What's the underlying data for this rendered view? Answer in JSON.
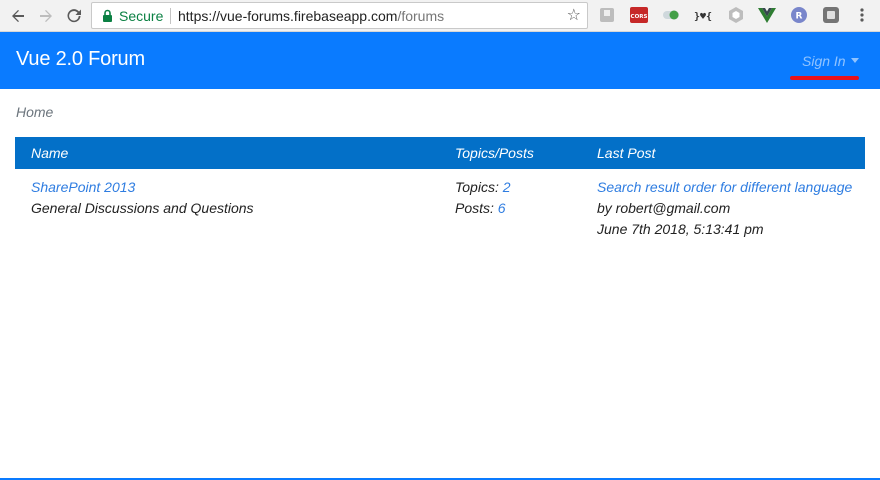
{
  "browser": {
    "secure_label": "Secure",
    "url_host": "https://vue-forums.firebaseapp.com",
    "url_path": "/forums",
    "extensions": [
      {
        "name": "bookmark-ext-icon",
        "color": "#9e9e9e",
        "text": ""
      },
      {
        "name": "cors-ext-icon",
        "color": "#d32f2f",
        "text": "CORS"
      },
      {
        "name": "toggle-ext-icon",
        "color": "#43a047",
        "text": ""
      },
      {
        "name": "json-ext-icon",
        "color": "#333333",
        "text": "}♥{"
      },
      {
        "name": "hexagon-ext-icon",
        "color": "#9e9e9e",
        "text": ""
      },
      {
        "name": "vue-devtools-icon",
        "color": "#2e7d32",
        "text": "V"
      },
      {
        "name": "r-ext-icon",
        "color": "#5c6bc0",
        "text": "R"
      },
      {
        "name": "gray-square-ext-icon",
        "color": "#757575",
        "text": ""
      }
    ]
  },
  "app": {
    "brand": "Vue 2.0 Forum",
    "signin_label": "Sign In",
    "accent": "#0a7bff",
    "header_row_color": "#0370c8",
    "annotation_color": "#e8121a"
  },
  "breadcrumb": {
    "home": "Home"
  },
  "table": {
    "headers": {
      "name": "Name",
      "topics_posts": "Topics/Posts",
      "last_post": "Last Post"
    },
    "rows": [
      {
        "forum_name": "SharePoint 2013",
        "forum_description": "General Discussions and Questions",
        "topics_label": "Topics: ",
        "topics_count": "2",
        "posts_label": "Posts: ",
        "posts_count": "6",
        "last_post_title": "Search result order for different language",
        "last_post_by": "by robert@gmail.com",
        "last_post_date": "June 7th 2018, 5:13:41 pm"
      }
    ]
  }
}
